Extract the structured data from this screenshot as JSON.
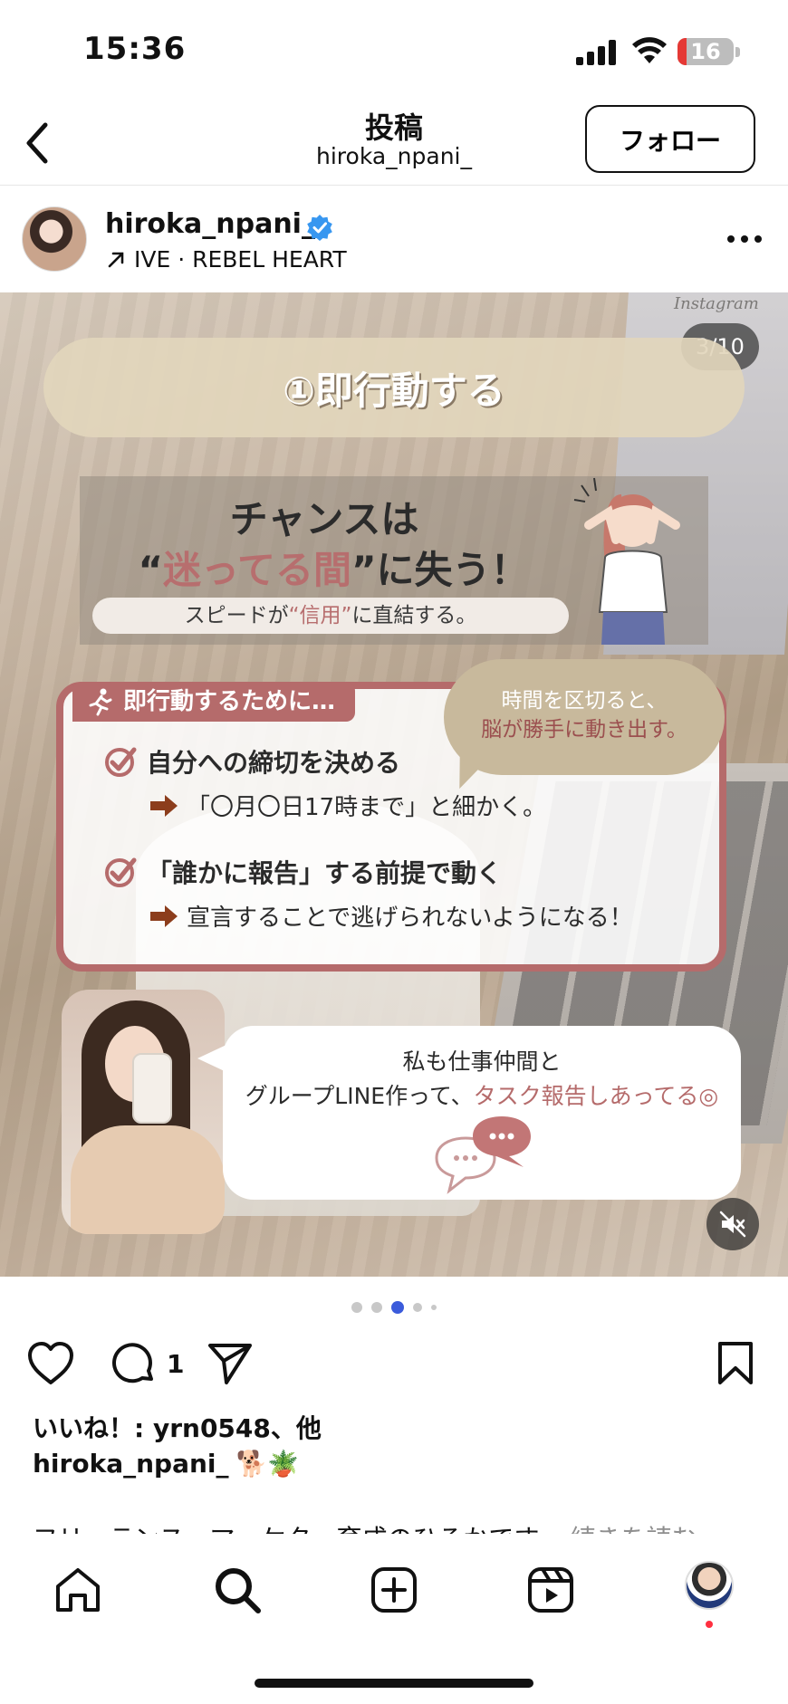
{
  "status": {
    "time": "15:36",
    "battery": "16",
    "battery_level": 0.16
  },
  "header": {
    "title": "投稿",
    "subtitle": "hiroka_npani_",
    "follow_label": "フォロー"
  },
  "post": {
    "username": "hiroka_npani_",
    "music": "IVE · REBEL HEART",
    "counter": "3/10"
  },
  "slide": {
    "step_title": "①即行動する",
    "chance_line1": "チャンスは",
    "chance_line2_a": "“",
    "chance_line2_em": "迷ってる間",
    "chance_line2_b": "”に失う！",
    "speed_a": "スピードが",
    "speed_em": "“信用”",
    "speed_b": "に直結する。",
    "laptop_label": "Instagram",
    "action_tab": "即行動するために…",
    "item1": "自分への締切を決める",
    "sub1": "「〇月〇日17時まで」と細かく。",
    "item2": "「誰かに報告」する前提で動く",
    "sub2": "宣言することで逃げられないようになる！",
    "bubble_l1": "時間を区切ると、",
    "bubble_l2": "脳が勝手に動き出す。",
    "msg_l1": "私も仕事仲間と",
    "msg_l2_a": "グループLINE作って、",
    "msg_l2_em": "タスク報告しあってる◎"
  },
  "engagement": {
    "comment_count": "1",
    "likes_text": "いいね！: yrn0548、他",
    "caption_user": "hiroka_npani_",
    "caption_emoji": "🐕🪴",
    "caption_text": "フリーランス・マーケター育成のひろかです。",
    "caption_more": "続きを読む"
  },
  "icons": {
    "back": "chevron-left-icon",
    "verified": "verified-badge-icon",
    "music": "arrow-up-right-icon",
    "more": "more-horizontal-icon",
    "mute": "speaker-muted-icon",
    "like": "heart-icon",
    "comment": "comment-icon",
    "share": "send-icon",
    "save": "bookmark-icon",
    "nav": [
      "home-icon",
      "search-icon",
      "create-icon",
      "reels-icon",
      "profile-icon"
    ]
  },
  "colors": {
    "accent_red": "#b56b6b",
    "verified_blue": "#3897f0",
    "beige": "#c8b99c",
    "active_dot": "#3b5bdb"
  }
}
